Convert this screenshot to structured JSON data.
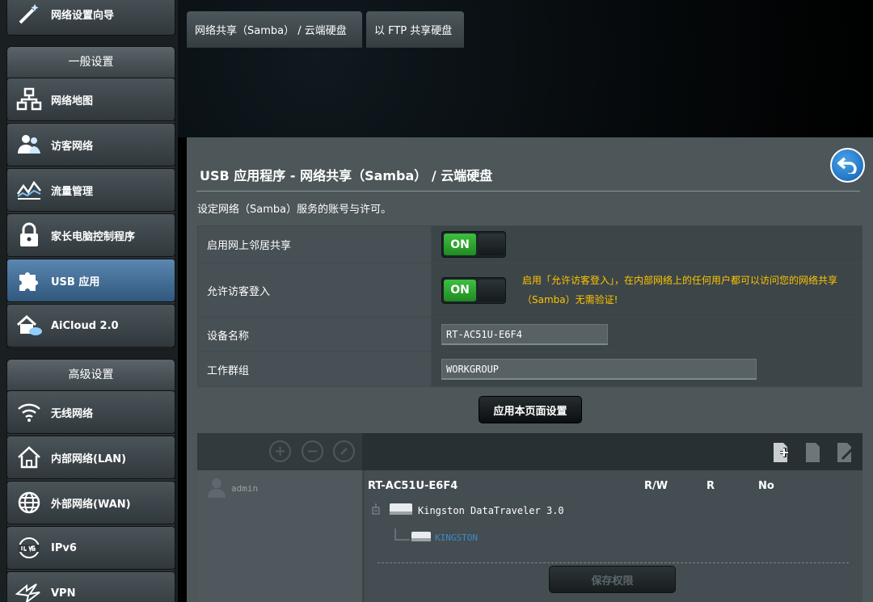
{
  "sidebar": {
    "wizard_label": "网络设置向导",
    "general_title": "一般设置",
    "general_items": [
      {
        "label": "网络地图",
        "icon": "network-map-icon"
      },
      {
        "label": "访客网络",
        "icon": "guest-network-icon"
      },
      {
        "label": "流量管理",
        "icon": "traffic-manager-icon"
      },
      {
        "label": "家长电脑控制程序",
        "icon": "parental-control-icon"
      },
      {
        "label": "USB 应用",
        "icon": "usb-app-icon"
      },
      {
        "label": "AiCloud 2.0",
        "icon": "aicloud-icon"
      }
    ],
    "advanced_title": "高级设置",
    "advanced_items": [
      {
        "label": "无线网络",
        "icon": "wireless-icon"
      },
      {
        "label": "内部网络(LAN)",
        "icon": "lan-icon"
      },
      {
        "label": "外部网络(WAN)",
        "icon": "wan-icon"
      },
      {
        "label": "IPv6",
        "icon": "ipv6-icon"
      },
      {
        "label": "VPN",
        "icon": "vpn-icon"
      }
    ]
  },
  "tabs": [
    {
      "label": "网络共享（Samba） / 云端硬盘"
    },
    {
      "label": "以 FTP 共享硬盘"
    }
  ],
  "panel": {
    "title": "USB 应用程序 - 网络共享（Samba） / 云端硬盘",
    "description": "设定网络（Samba）服务的账号与许可。",
    "rows": {
      "neighbor_label": "启用网上邻居共享",
      "neighbor_toggle": "ON",
      "guest_label": "允许访客登入",
      "guest_toggle": "ON",
      "guest_hint": "启用「允许访客登入」，在内部网络上的任何用户都可以访问您的网络共享（Samba）无需验证!",
      "device_label": "设备名称",
      "device_value": "RT-AC51U-E6F4",
      "workgroup_label": "工作群组",
      "workgroup_value": "WORKGROUP"
    },
    "apply_label": "应用本页面设置"
  },
  "permissions": {
    "user": "admin",
    "device": "RT-AC51U-E6F4",
    "col_rw": "R/W",
    "col_r": "R",
    "col_no": "No",
    "drive": "Kingston DataTraveler 3.0",
    "partition": "KINGSTON",
    "save_label": "保存权限"
  },
  "colors": {
    "accent": "#31587d",
    "toggle_on": "#2aa12c",
    "hint": "#ffc400",
    "partition_link": "#3e8ac6"
  }
}
